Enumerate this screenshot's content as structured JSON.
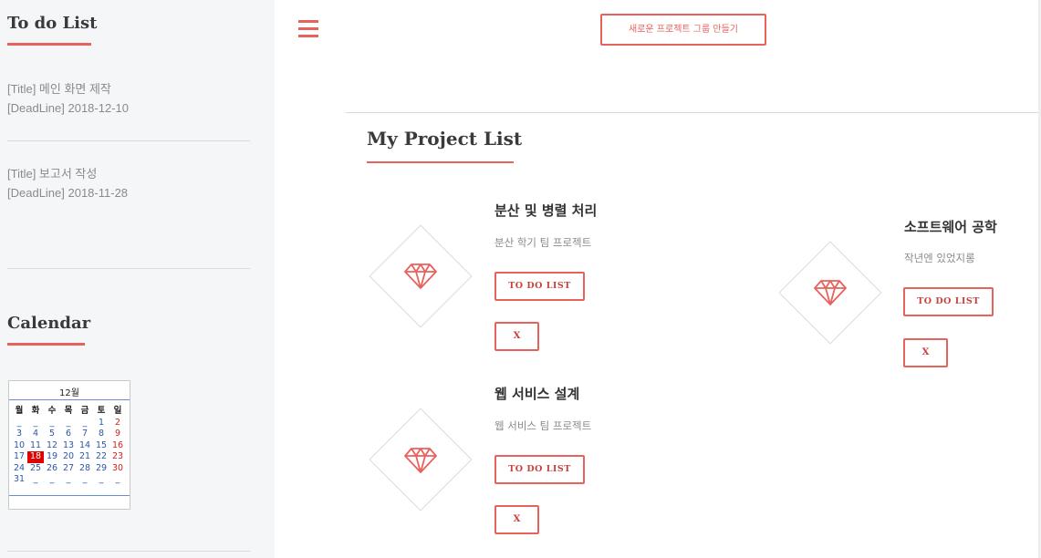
{
  "sidebar": {
    "todo_heading": "To do List",
    "todos": [
      {
        "title": "[Title] 메인 화면 제작",
        "deadline": "[DeadLine] 2018-12-10"
      },
      {
        "title": "[Title] 보고서 작성",
        "deadline": "[DeadLine] 2018-11-28"
      }
    ],
    "calendar_heading": "Calendar"
  },
  "calendar": {
    "month": "12월",
    "weekdays": [
      "월",
      "화",
      "수",
      "목",
      "금",
      "토",
      "일"
    ],
    "weeks": [
      [
        "_",
        "_",
        "_",
        "_",
        "_",
        "1",
        "2"
      ],
      [
        "3",
        "4",
        "5",
        "6",
        "7",
        "8",
        "9"
      ],
      [
        "10",
        "11",
        "12",
        "13",
        "14",
        "15",
        "16"
      ],
      [
        "17",
        "18",
        "19",
        "20",
        "21",
        "22",
        "23"
      ],
      [
        "24",
        "25",
        "26",
        "27",
        "28",
        "29",
        "30"
      ],
      [
        "31",
        "_",
        "_",
        "_",
        "_",
        "_",
        "_"
      ]
    ],
    "today": "18"
  },
  "header": {
    "new_group_label": "새로운 프로젝트 그룹 만들기",
    "menu_icon": "hamburger-icon"
  },
  "main": {
    "heading": "My Project List",
    "projects": [
      {
        "title": "분산 및 병렬 처리",
        "description": "분산 학기 팀 프로젝트",
        "todo_label": "TO DO LIST",
        "delete_label": "X",
        "icon": "diamond-gem-icon"
      },
      {
        "title": "소프트웨어 공학",
        "description": "작년엔 있었지롱",
        "todo_label": "TO DO LIST",
        "delete_label": "X",
        "icon": "diamond-gem-icon"
      },
      {
        "title": "웹 서비스 설계",
        "description": "웹 서비스 팀 프로젝트",
        "todo_label": "TO DO LIST",
        "delete_label": "X",
        "icon": "diamond-gem-icon"
      }
    ]
  },
  "colors": {
    "accent": "#e8625d",
    "sidebar_bg": "#f5f6f8",
    "today_highlight": "#e00000",
    "calendar_blue": "#2c56a8"
  }
}
